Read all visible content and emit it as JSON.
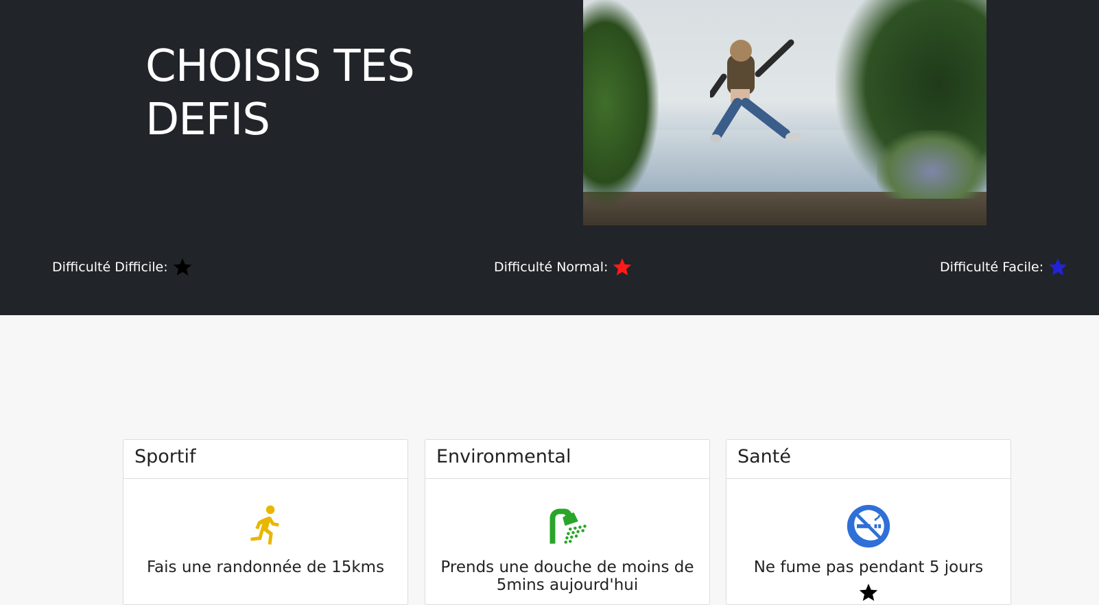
{
  "hero": {
    "title": "CHOISIS TES\nDEFIS",
    "photo_alt": "personne qui saute"
  },
  "difficulties": [
    {
      "label": "Difficulté Difficile:",
      "color": "#000000",
      "icon": "star-icon"
    },
    {
      "label": "Difficulté Normal:",
      "color": "#ff1a1a",
      "icon": "star-icon"
    },
    {
      "label": "Difficulté Facile:",
      "color": "#2323d6",
      "icon": "star-icon"
    }
  ],
  "cards": [
    {
      "header": "Sportif",
      "icon": "running-person-icon",
      "icon_color": "#e9b600",
      "text": "Fais une randonnée de 15kms"
    },
    {
      "header": "Environmental",
      "icon": "shower-icon",
      "icon_color": "#2aa52a",
      "text": "Prends une douche de moins de 5mins aujourd'hui"
    },
    {
      "header": "Santé",
      "icon": "no-smoking-icon",
      "icon_color": "#2f6fd8",
      "text": "Ne fume pas pendant 5 jours",
      "difficulty_color": "#000000"
    }
  ]
}
